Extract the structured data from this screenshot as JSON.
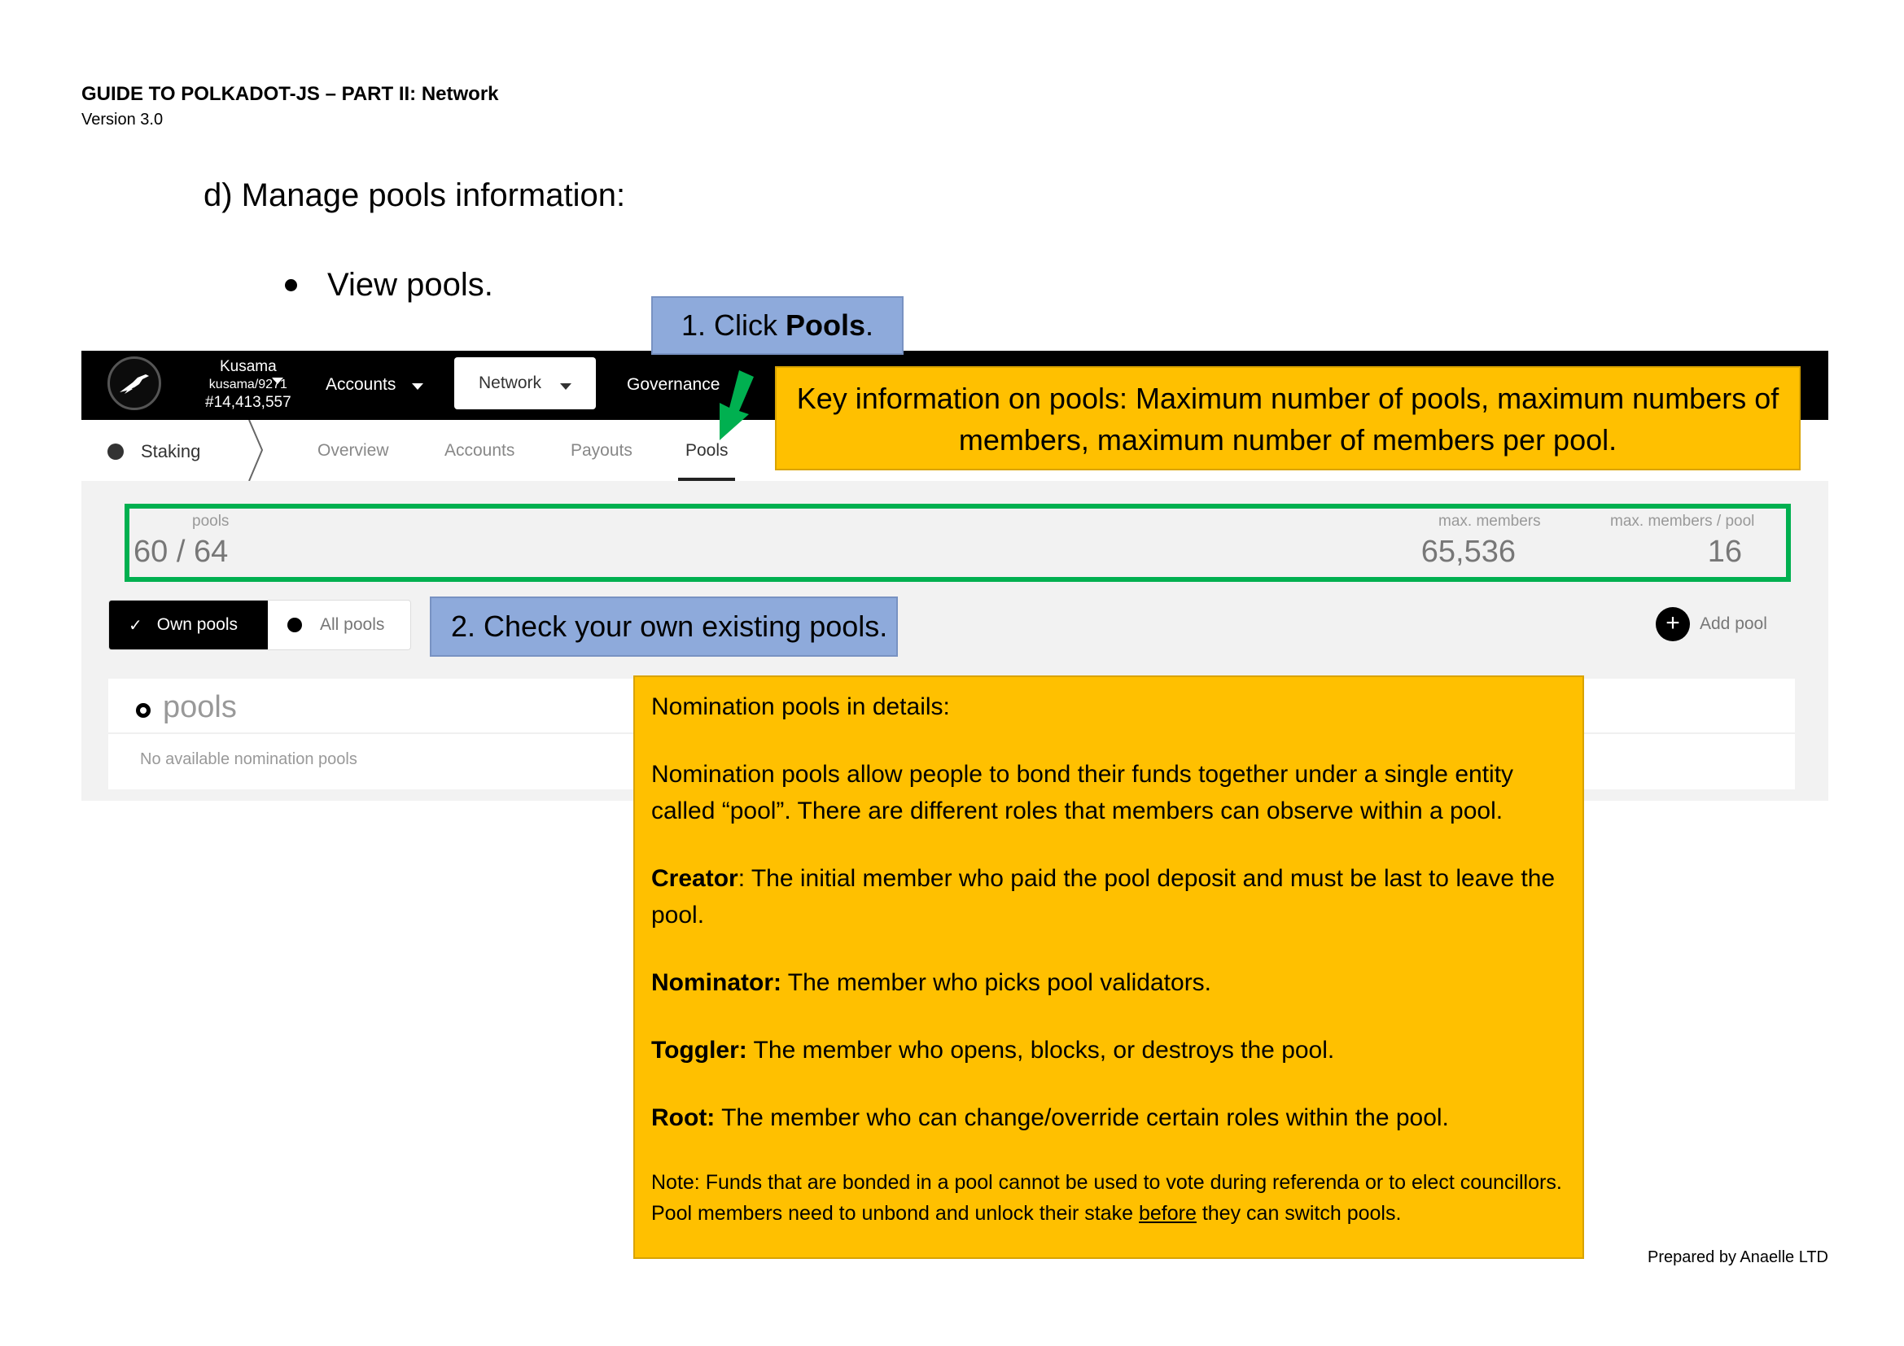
{
  "document": {
    "title": "GUIDE TO POLKADOT-JS – PART II: Network",
    "version": "Version 3.0",
    "section_heading": "d) Manage pools information:",
    "bullet": "View pools.",
    "footer": "Prepared by Anaelle LTD"
  },
  "callouts": {
    "click_pools_prefix": "1. Click ",
    "click_pools_bold": "Pools",
    "click_pools_suffix": ".",
    "key_info": "Key information on pools: Maximum number of pools, maximum numbers of members, maximum number of members per pool.",
    "check_own": "2. Check your own existing pools.",
    "details": {
      "heading": "Nomination pools in details:",
      "intro": "Nomination pools allow people to bond their funds together under a single entity called “pool”. There are different roles that members can observe within a pool.",
      "creator_label": "Creator",
      "creator_text": ": The initial member who paid the pool deposit and must be last to leave the pool.",
      "nominator_label": "Nominator:",
      "nominator_text": " The member who picks pool validators.",
      "toggler_label": "Toggler:",
      "toggler_text": " The member who opens, blocks, or destroys the pool.",
      "root_label": "Root:",
      "root_text": " The member who can change/override certain roles within the pool.",
      "note_before": "Note: Funds that are bonded in a pool cannot be used to vote during referenda or to elect councillors. Pool members need to unbond and unlock their stake ",
      "note_underlined": "before",
      "note_after": " they can switch pools."
    }
  },
  "app": {
    "chain": {
      "name": "Kusama",
      "version": "kusama/9271",
      "block": "#14,413,557"
    },
    "topnav": {
      "accounts": "Accounts",
      "network": "Network",
      "governance": "Governance"
    },
    "subnav": {
      "section": "Staking",
      "tabs": [
        "Overview",
        "Accounts",
        "Payouts",
        "Pools"
      ]
    },
    "summary": {
      "pools_label": "pools",
      "pools_value": "60 / 64",
      "max_members_label": "max. members",
      "max_members_value": "65,536",
      "max_per_pool_label": "max. members / pool",
      "max_per_pool_value": "16"
    },
    "toggle": {
      "own": "Own pools",
      "all": "All pools"
    },
    "add_pool": "Add pool",
    "table": {
      "header": "pools",
      "empty": "No available nomination pools"
    }
  },
  "colors": {
    "callout_blue": "#8eaadb",
    "callout_yellow": "#ffc000",
    "highlight_green": "#00b050"
  }
}
